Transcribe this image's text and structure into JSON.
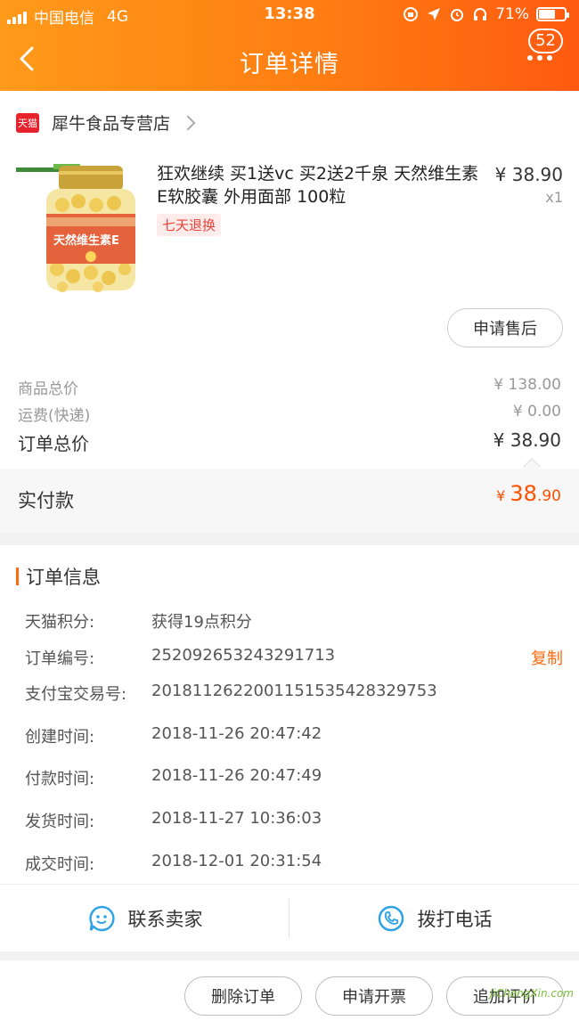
{
  "status_bar": {
    "carrier": "中国电信",
    "network": "4G",
    "time": "13:38",
    "battery": "71%",
    "battery_level": 0.71
  },
  "nav": {
    "title": "订单详情",
    "badge": "52"
  },
  "store": {
    "logo_text": "天猫",
    "name": "犀牛食品专营店"
  },
  "product": {
    "title": "狂欢继续 买1送vc 买2送2千泉 天然维生素E软胶囊 外用面部 100粒",
    "return_tag": "七天退换",
    "price": "¥ 38.90",
    "qty": "x1",
    "after_sale_label": "申请售后",
    "label_text": "天然维生素E"
  },
  "prices": {
    "goods_label": "商品总价",
    "goods_value": "¥ 138.00",
    "shipping_label": "运费(快递)",
    "shipping_value": "¥ 0.00",
    "order_label": "订单总价",
    "order_value": "¥ 38.90",
    "paid_label": "实付款",
    "paid_yen": "¥",
    "paid_int": "38",
    "paid_dec": ".90"
  },
  "order_info": {
    "title": "订单信息",
    "rows": [
      {
        "key": "天猫积分:",
        "value": "获得19点积分"
      },
      {
        "key": "订单编号:",
        "value": "252092653243291713"
      },
      {
        "key": "支付宝交易号:",
        "value": "2018112622001151535428329753"
      },
      {
        "key": "创建时间:",
        "value": "2018-11-26 20:47:42"
      },
      {
        "key": "付款时间:",
        "value": "2018-11-26 20:47:49"
      },
      {
        "key": "发货时间:",
        "value": "2018-11-27 10:36:03"
      },
      {
        "key": "成交时间:",
        "value": "2018-12-01 20:31:54"
      }
    ],
    "copy_label": "复制"
  },
  "contact": {
    "seller_label": "联系卖家",
    "phone_label": "拨打电话"
  },
  "actions": {
    "delete_label": "删除订单",
    "invoice_label": "申请开票",
    "review_label": "追加评价"
  },
  "watermark": "JiChengXin.com",
  "colors": {
    "accent": "#ff6a10",
    "header_start": "#ff9a1a",
    "header_end": "#ff5a10",
    "price_red": "#ff5000"
  }
}
